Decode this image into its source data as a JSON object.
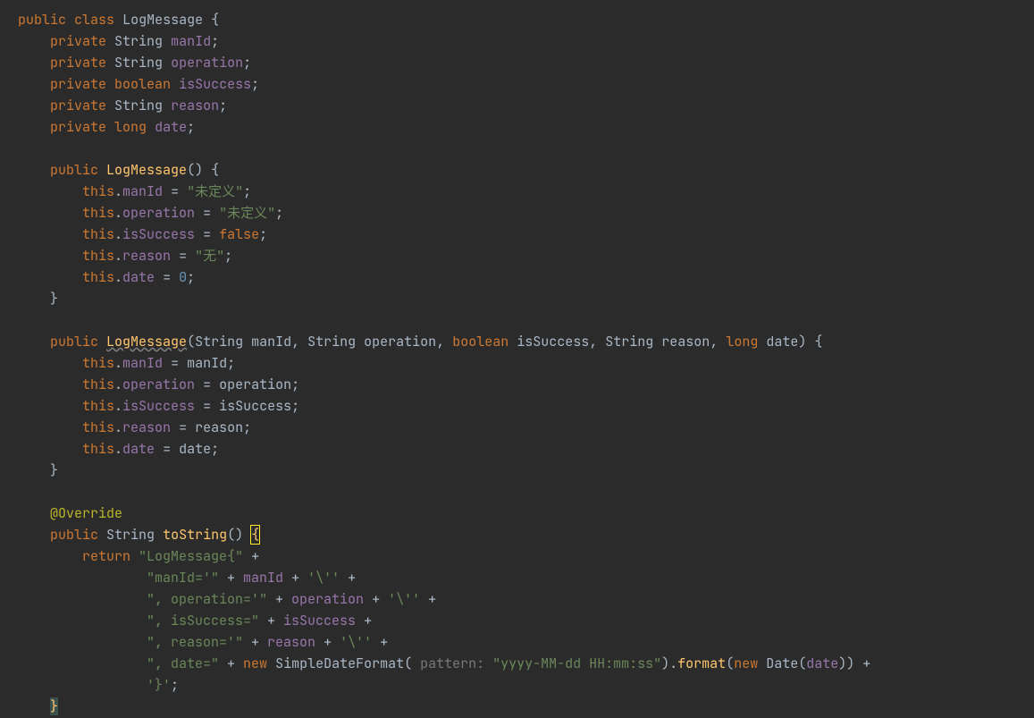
{
  "code": {
    "kw_public": "public",
    "kw_class": "class",
    "kw_private": "private",
    "kw_boolean": "boolean",
    "kw_long": "long",
    "kw_this": "this",
    "kw_false": "false",
    "kw_return": "return",
    "kw_new": "new",
    "cls": "LogMessage",
    "t_String": "String",
    "t_Date": "Date",
    "t_SDF": "SimpleDateFormat",
    "f_manId": "manId",
    "f_operation": "operation",
    "f_isSuccess": "isSuccess",
    "f_reason": "reason",
    "f_date": "date",
    "s_undef": "\"未定义\"",
    "s_none": "\"无\"",
    "n_zero": "0",
    "ann_override": "@Override",
    "m_toString": "toString",
    "m_format": "format",
    "s_lm": "\"LogMessage{\"",
    "s_manId": "\"manId='\"",
    "s_q": "'\\''",
    "s_op": "\", operation='\"",
    "s_is": "\", isSuccess=\"",
    "s_re": "\", reason='\"",
    "s_da": "\", date=\"",
    "s_pat": "\"yyyy-MM-dd HH:mm:ss\"",
    "s_end": "'}'",
    "p_hint": "pattern:"
  }
}
